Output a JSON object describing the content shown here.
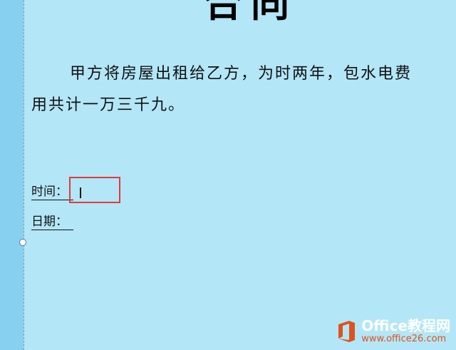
{
  "document": {
    "title": "合同",
    "paragraph": {
      "line1": "甲方将房屋出租给乙方，为时两年，包水电费",
      "line2": "用共计一万三千九。"
    },
    "fields": {
      "time_label": "时间：",
      "date_label": "日期："
    }
  },
  "watermark": {
    "brand": "Office教程网",
    "url": "www.office26.com"
  },
  "colors": {
    "background": "#b3e6f7",
    "margin_band": "#88d0ef",
    "highlight": "#e53935",
    "logo": "#e0521b"
  }
}
